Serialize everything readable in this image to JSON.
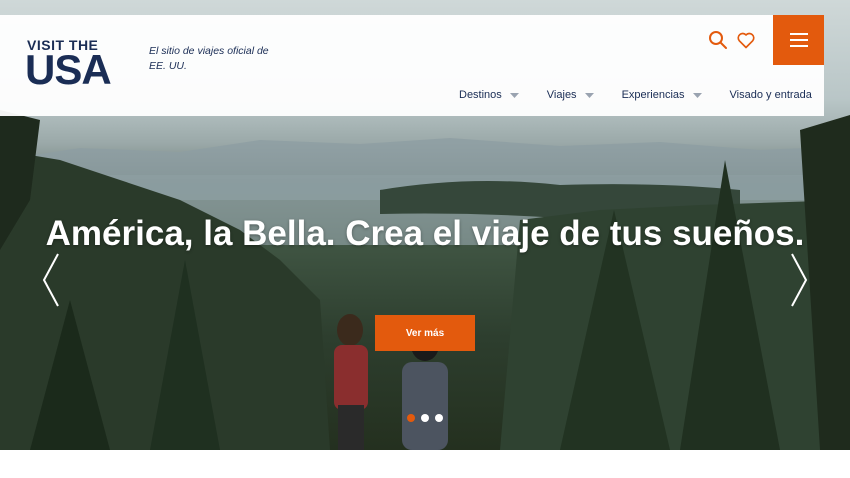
{
  "brand": {
    "logo_top": "VISIT THE",
    "logo_bottom": "USA",
    "tagline": "El sitio de viajes oficial de EE. UU."
  },
  "header": {
    "icons": [
      "search-icon",
      "heart-icon",
      "menu-icon"
    ],
    "nav": [
      {
        "label": "Destinos",
        "has_caret": true
      },
      {
        "label": "Viajes",
        "has_caret": true
      },
      {
        "label": "Experiencias",
        "has_caret": true
      },
      {
        "label": "Visado y entrada",
        "has_caret": false
      }
    ]
  },
  "hero": {
    "headline": "América, la Bella. Crea el viaje de tus sueños.",
    "cta_label": "Ver más",
    "slides_count": 3,
    "active_slide": 1
  },
  "colors": {
    "accent": "#e35a0d",
    "brand_navy": "#1a2d55"
  }
}
